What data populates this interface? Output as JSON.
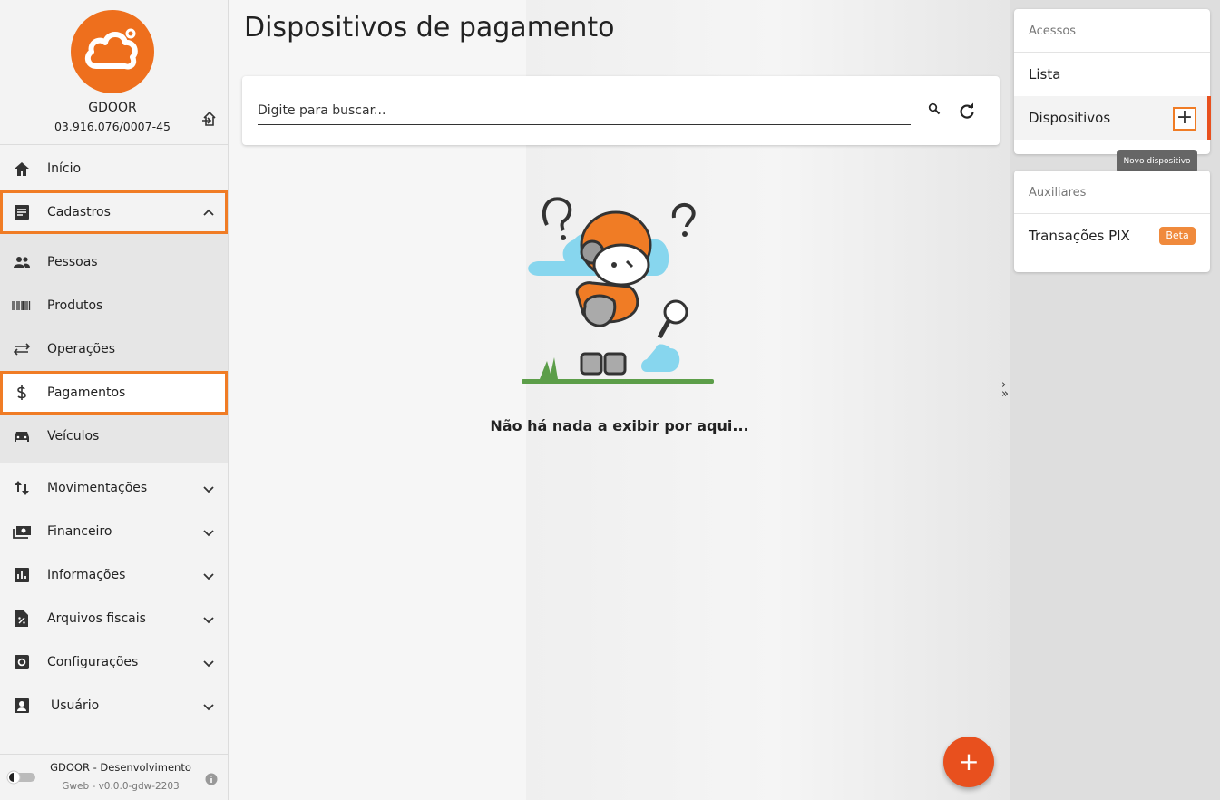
{
  "colors": {
    "accent": "#f07c25",
    "fab": "#e8501e",
    "logo": "#ee6f1d"
  },
  "sidebar": {
    "company_name": "GDOOR",
    "cnpj": "03.916.076/0007-45",
    "items": [
      {
        "label": "Início",
        "icon": "home-icon"
      },
      {
        "label": "Cadastros",
        "icon": "list-icon"
      },
      {
        "label": "Pessoas",
        "icon": "people-icon"
      },
      {
        "label": "Produtos",
        "icon": "barcode-icon"
      },
      {
        "label": "Operações",
        "icon": "swap-icon"
      },
      {
        "label": "Pagamentos",
        "icon": "dollar-icon"
      },
      {
        "label": "Veículos",
        "icon": "car-icon"
      },
      {
        "label": "Movimentações",
        "icon": "sort-icon"
      },
      {
        "label": "Financeiro",
        "icon": "money-icon"
      },
      {
        "label": "Informações",
        "icon": "chart-icon"
      },
      {
        "label": "Arquivos fiscais",
        "icon": "file-percent-icon"
      },
      {
        "label": "Configurações",
        "icon": "gear-icon"
      },
      {
        "label": "Usuário",
        "icon": "user-icon"
      }
    ],
    "footer": {
      "environment": "GDOOR - Desenvolvimento",
      "version": "Gweb - v0.0.0-gdw-2203"
    }
  },
  "main": {
    "title": "Dispositivos de pagamento",
    "search_placeholder": "Digite para buscar...",
    "empty_text": "Não há nada a exibir por aqui...",
    "expand_glyph": "›\n»",
    "fab_label": "+"
  },
  "right": {
    "accessos_header": "Acessos",
    "accessos_items": [
      {
        "label": "Lista"
      },
      {
        "label": "Dispositivos"
      }
    ],
    "add_button_label": "+",
    "tooltip": "Novo dispositivo",
    "auxiliares_header": "Auxiliares",
    "auxiliares_items": [
      {
        "label": "Transações PIX",
        "badge": "Beta"
      }
    ]
  }
}
